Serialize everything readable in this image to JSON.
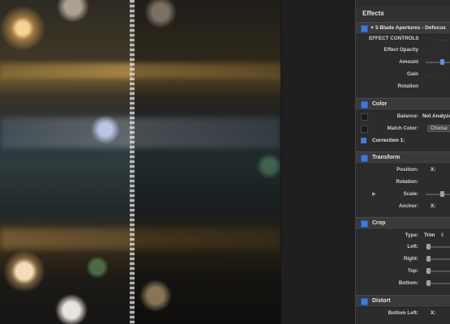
{
  "inspector": {
    "title": "Effects",
    "effect": {
      "name": "5 Blade Apertures - Defocus",
      "section": "EFFECT CONTROLS",
      "rows": [
        {
          "label": "Effect Opacity"
        },
        {
          "label": "Amount"
        },
        {
          "label": "Gain"
        },
        {
          "label": "Rotation"
        }
      ]
    },
    "color": {
      "header": "Color",
      "balance_label": "Balance:",
      "balance_value": "Not Analyzed",
      "match_label": "Match Color:",
      "match_button": "Choose",
      "correction": "Correction 1:"
    },
    "transform": {
      "header": "Transform",
      "position_label": "Position:",
      "position_axis": "X:",
      "rotation_label": "Rotation:",
      "scale_label": "Scale:",
      "anchor_label": "Anchor:",
      "anchor_axis": "X:"
    },
    "crop": {
      "header": "Crop",
      "type_label": "Type:",
      "type_value": "Trim",
      "left_label": "Left:",
      "right_label": "Right:",
      "top_label": "Top:",
      "bottom_label": "Bottom:"
    },
    "distort": {
      "header": "Distort",
      "bottom_left_label": "Bottom Left:",
      "bottom_left_axis": "X:"
    },
    "accent_color": "#3d7ae0"
  }
}
